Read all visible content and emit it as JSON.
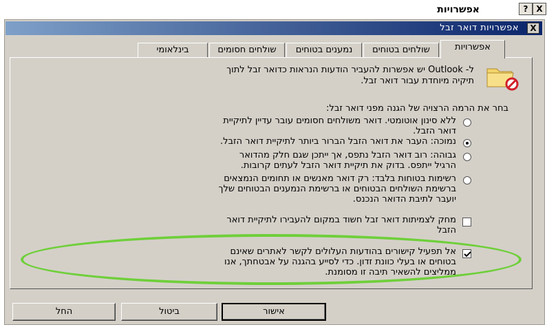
{
  "window": {
    "title": "אפשרויות",
    "title_buttons": [
      "?",
      "X"
    ]
  },
  "dialog": {
    "title": "אפשרויות דואר זבל",
    "close_label": "X"
  },
  "tabs": [
    {
      "label": "אפשרויות",
      "active": true
    },
    {
      "label": "שולחים בטוחים",
      "active": false
    },
    {
      "label": "נמענים בטוחים",
      "active": false
    },
    {
      "label": "שולחים חסומים",
      "active": false
    },
    {
      "label": "בינלאומי",
      "active": false
    }
  ],
  "intro": {
    "line1": "ל- Outlook יש אפשרות להעביר הודעות הנראות כדואר זבל לתוך",
    "line2": "תיקיה מיוחדת עבור דואר זבל."
  },
  "prompt": "בחר את הרמה הרצויה של הגנה מפני דואר זבל:",
  "options": [
    {
      "lines": [
        "ללא סינון אוטומטי. דואר משולחים חסומים עובר עדיין לתיקיית",
        "דואר הזבל."
      ],
      "selected": false
    },
    {
      "lines": [
        "נמוכה: העבר את דואר הזבל הברור ביותר לתיקיית דואר הזבל."
      ],
      "selected": true
    },
    {
      "lines": [
        "גבוהה: רוב דואר הזבל נתפס, אך ייתכן שגם חלק מהדואר",
        "הרגיל ייתפס. בדוק את תיקיית דואר הזבל לעתים קרובות."
      ],
      "selected": false
    },
    {
      "lines": [
        "רשימות בטוחות בלבד: רק דואר מאנשים או תחומים הנמצאים",
        "ברשימת השולחים הבטוחים או ברשימת הנמענים הבטוחים שלך",
        "יועבר לתיבת הדואר הנכנס."
      ],
      "selected": false
    }
  ],
  "checkboxes": [
    {
      "lines": [
        "מחק לצמיתות דואר זבל חשוד במקום להעבירו לתיקיית דואר",
        "הזבל"
      ],
      "checked": false
    },
    {
      "lines": [
        "אל תפעיל קישורים בהודעות העלולים לקשר לאתרים שאינם",
        "בטוחים או בעלי כוונת זדון. כדי לסייע בהגנה על אבטחתך, אנו",
        "ממליצים להשאיר תיבה זו מסומנת."
      ],
      "checked": true
    }
  ],
  "buttons": {
    "ok": "אישור",
    "cancel": "ביטול",
    "apply": "החל"
  },
  "colors": {
    "highlight": "#6fcf3a",
    "titlebar": "#0a246a"
  }
}
